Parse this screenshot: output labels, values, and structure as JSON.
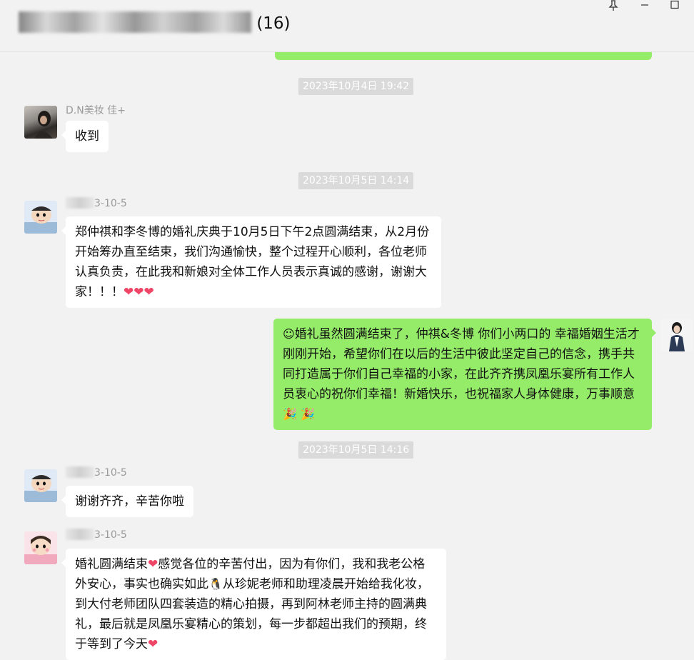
{
  "window": {
    "title_suffix": "(16)",
    "pin_icon": "pin-icon",
    "minimize_icon": "minimize-icon",
    "maximize_icon": "maximize-icon"
  },
  "timestamps": [
    "2023年10月4日 19:42",
    "2023年10月5日 14:14",
    "2023年10月5日 14:16"
  ],
  "messages": [
    {
      "sender": "D.N美妆  佳+",
      "text": "收到"
    },
    {
      "sender": "3-10-5",
      "text": "郑仲祺和李冬博的婚礼庆典于10月5日下午2点圆满结束，从2月份开始筹办直至结束，我们沟通愉快，整个过程开心顺利，各位老师认真负责，在此我和新娘对全体工作人员表示真诚的感谢，谢谢大家！！！",
      "hearts": "❤❤❤"
    },
    {
      "sender": "me",
      "text_a": "婚礼虽然圆满结束了，仲祺&冬博  你们小两口的  幸福婚姻生活才刚刚开始，希望你们在以后的生活中彼此坚定自己的信念，携手共同打造属于你们自己幸福的小家，在此齐齐携凤凰乐宴所有工作人员衷心的祝你们幸福！新婚快乐，也祝福家人身体健康，万事顺意",
      "emoji_start": "☺",
      "emoji_end": "🎉 🎉"
    },
    {
      "sender": "3-10-5",
      "text": "谢谢齐齐，辛苦你啦"
    },
    {
      "sender": "3-10-5",
      "text_a": "婚礼圆满结束",
      "text_b": "感觉各位的辛苦付出，因为有你们，我和我老公格外安心，事实也确实如此",
      "text_c": "从珍妮老师和助理凌晨开始给我化妆，到大付老师团队四套装造的精心拍摄，再到阿林老师主持的圆满典礼，最后就是凤凰乐宴精心的策划，每一步都超出我们的预期，终于等到了今天",
      "heart": "❤",
      "penguin": "🐧"
    }
  ]
}
